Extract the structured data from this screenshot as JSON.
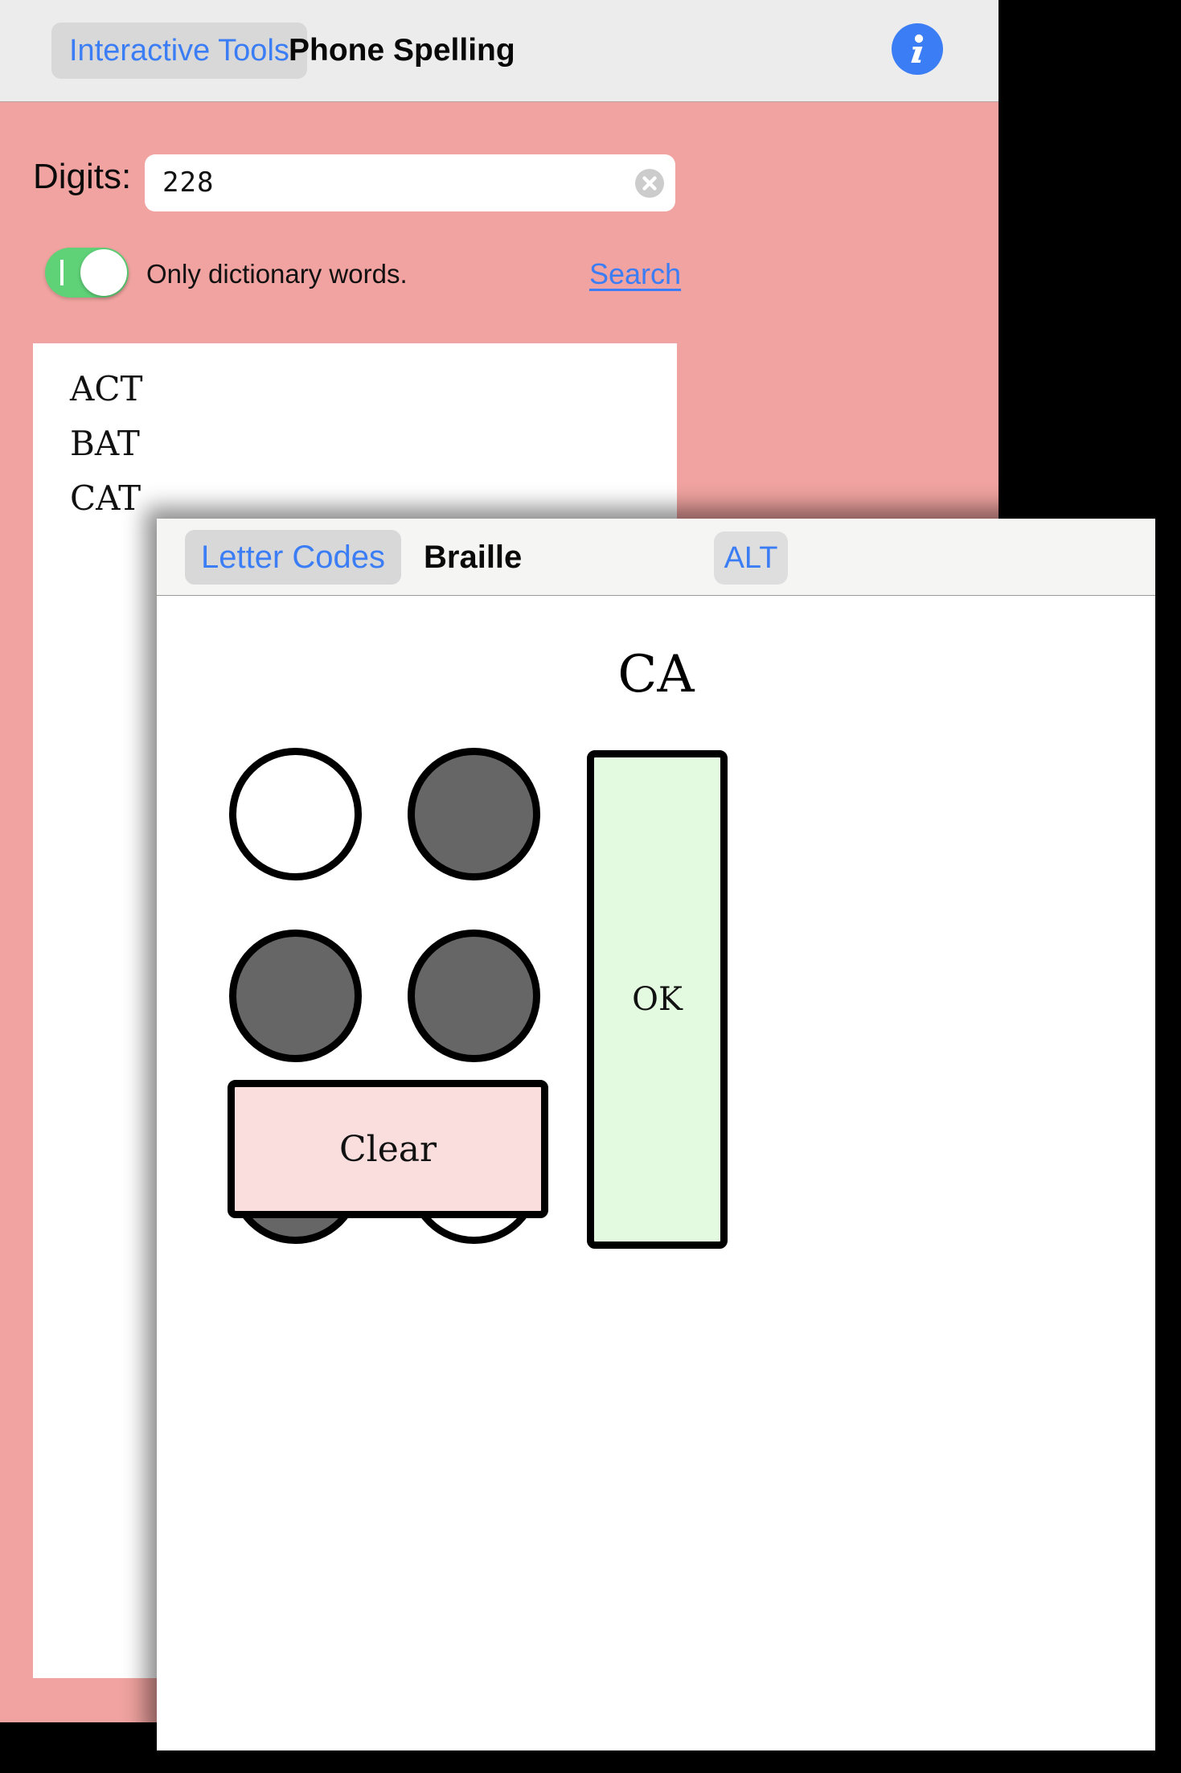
{
  "app": {
    "navbar": {
      "back_label": "Interactive Tools",
      "title": "Phone Spelling",
      "info_icon": "info-circle-icon"
    },
    "form": {
      "digits_label": "Digits:",
      "digits_value": "228",
      "digits_placeholder": "",
      "clear_icon": "clear-circle-x-icon",
      "dictionary_toggle_label": "Only dictionary words.",
      "dictionary_toggle_state": "on",
      "search_link_label": "Search"
    },
    "results": [
      "ACT",
      "BAT",
      "CAT"
    ]
  },
  "modal": {
    "navbar": {
      "back_label": "Letter Codes",
      "title": "Braille",
      "alt_label": "ALT"
    },
    "letter": "CA",
    "braille": {
      "rows": [
        [
          {
            "state": "off"
          },
          {
            "state": "on"
          }
        ],
        [
          {
            "state": "on"
          },
          {
            "state": "on"
          }
        ],
        [
          {
            "state": "on"
          },
          {
            "state": "off"
          }
        ]
      ]
    },
    "ok_label": "OK",
    "clear_label": "Clear"
  },
  "colors": {
    "app_background": "#F0A3A0",
    "navbar": "#ECECEC",
    "accent_link": "#3B7DF5",
    "toggle_on": "#5FD278",
    "dot_filled": "#666666",
    "ok_button": "#E3FAE0",
    "clear_button": "#FADEDE"
  }
}
